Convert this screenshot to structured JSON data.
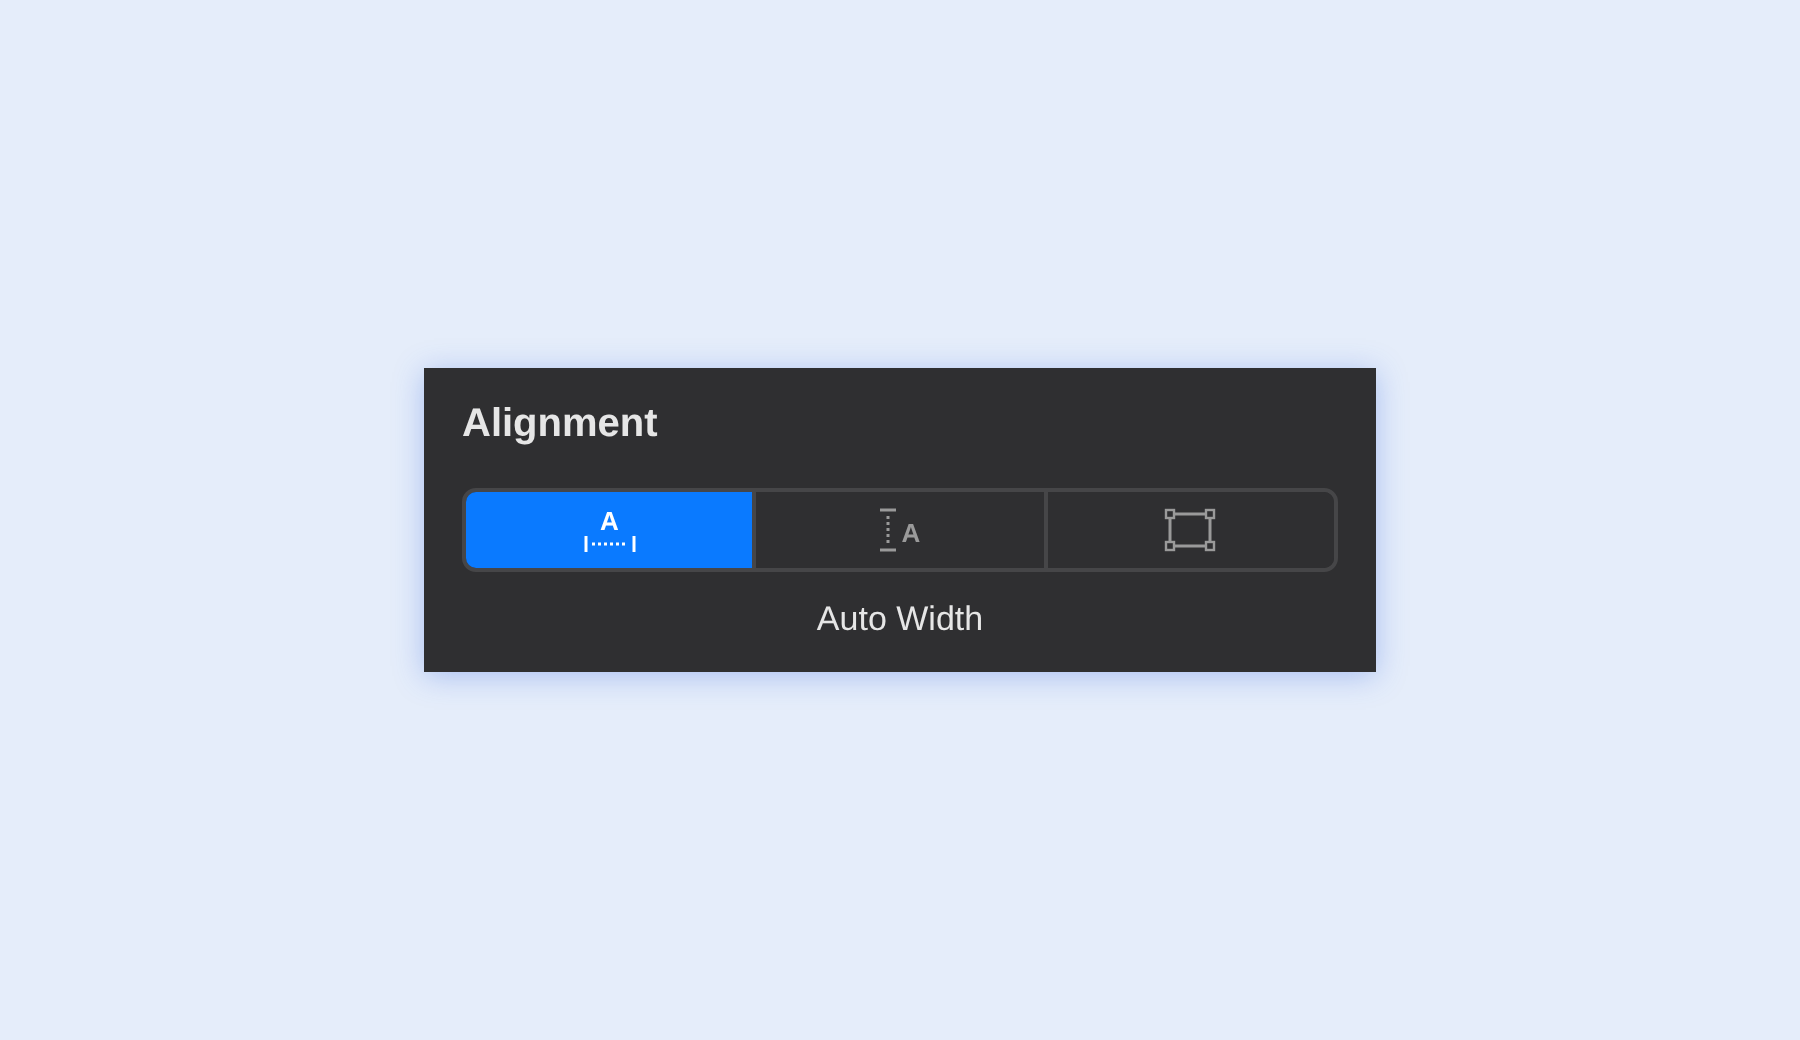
{
  "panel": {
    "title": "Alignment",
    "segments": [
      {
        "kind": "auto-width",
        "letter": "A",
        "selected": true
      },
      {
        "kind": "auto-height",
        "letter": "A",
        "selected": false
      },
      {
        "kind": "fixed",
        "selected": false
      }
    ],
    "caption": "Auto Width"
  }
}
